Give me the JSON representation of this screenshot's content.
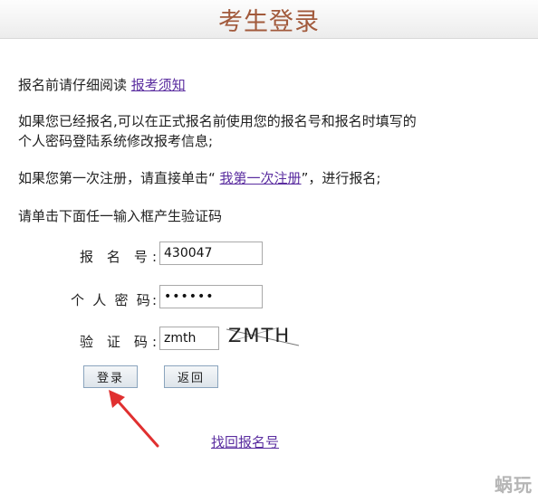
{
  "header": {
    "title": "考生登录"
  },
  "notice": {
    "prefix": "报名前请仔细阅读 ",
    "link_label": "报考须知"
  },
  "instructions": {
    "line1": "如果您已经报名,可以在正式报名前使用您的报名号和报名时填写的",
    "line2": "个人密码登陆系统修改报考信息;",
    "first_time_prefix": "如果您第一次注册，请直接单击“ ",
    "first_time_link": "我第一次注册",
    "first_time_suffix": "”，进行报名;",
    "captcha_hint": "请单击下面任一输入框产生验证码"
  },
  "form": {
    "reg_no_label": "报 名 号:",
    "reg_no_value": "430047",
    "password_label": "个 人 密 码:",
    "password_value": "••••••",
    "captcha_label": "验 证 码:",
    "captcha_value": "zmth",
    "captcha_text": "ZMTH"
  },
  "buttons": {
    "login": "登录",
    "back": "返回"
  },
  "footer": {
    "find_link": "找回报名号"
  },
  "watermark": "蜗玩",
  "colors": {
    "title": "#a25a3c",
    "link": "#5b2ea0",
    "arrow": "#e03030"
  }
}
